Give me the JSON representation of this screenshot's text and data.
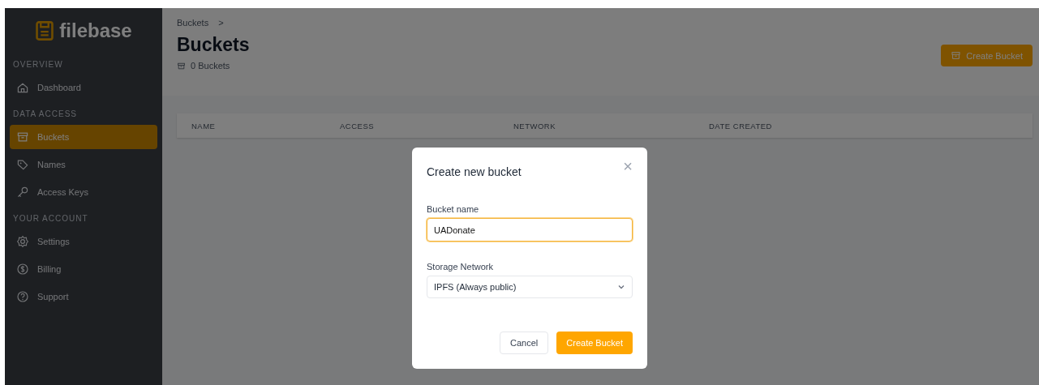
{
  "sidebar": {
    "logo": "filebase",
    "sections": [
      {
        "title": "OVERVIEW",
        "items": [
          {
            "label": "Dashboard",
            "selected": false
          }
        ]
      },
      {
        "title": "DATA ACCESS",
        "items": [
          {
            "label": "Buckets",
            "selected": true
          },
          {
            "label": "Names",
            "selected": false
          },
          {
            "label": "Access Keys",
            "selected": false
          }
        ]
      },
      {
        "title": "YOUR ACCOUNT",
        "items": [
          {
            "label": "Settings",
            "selected": false
          },
          {
            "label": "Billing",
            "selected": false
          },
          {
            "label": "Support",
            "selected": false
          }
        ]
      }
    ]
  },
  "breadcrumb": [
    "Buckets",
    ">"
  ],
  "page_title": "Buckets",
  "bucket_count": "0 Buckets",
  "create_button": "Create Bucket",
  "table": {
    "columns": [
      "NAME",
      "ACCESS",
      "NETWORK",
      "DATE CREATED"
    ]
  },
  "dialog": {
    "title": "Create new bucket",
    "close": "×",
    "name_label": "Bucket name",
    "name_value": "UADonate",
    "network_label": "Storage Network",
    "network_value": "IPFS (Always public)",
    "buttons": [
      {
        "label": "Cancel",
        "kind": "secondary"
      },
      {
        "label": "Create Bucket",
        "kind": "primary"
      }
    ]
  }
}
